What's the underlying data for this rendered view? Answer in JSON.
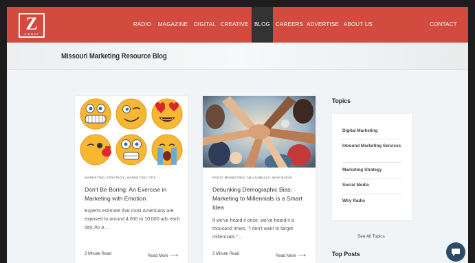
{
  "logo": {
    "letter": "Z",
    "subtitle": "ZIMMER"
  },
  "nav": {
    "items": [
      "RADIO",
      "MAGAZINE",
      "DIGITAL",
      "CREATIVE",
      "BLOG",
      "CAREERS",
      "ADVERTISE",
      "ABOUT US"
    ],
    "active": "BLOG",
    "contact": "CONTACT"
  },
  "page": {
    "title": "Missouri Marketing Resource Blog"
  },
  "posts": [
    {
      "categories": "MARKETING STRATEGY, MARKETING TIPS",
      "title": "Don't Be Boring: An Exercise in Marketing with Emotion",
      "excerpt": "Experts estimate that most Americans are exposed to around 4,000 to 10,000 ads each day. As a…",
      "read_time": "3 Minute Read",
      "read_more": "Read More"
    },
    {
      "categories": "RADIO MARKETING, MILLENNIALS, WHY RADIO",
      "title": "Debunking Demographic Bias: Marketing to Millennials is a Smart Idea",
      "excerpt": "If we've heard it once, we've heard it a thousand times, \"I don't want to target millennials.\"…",
      "read_time": "3 Minute Read",
      "read_more": "Read More"
    }
  ],
  "sidebar": {
    "topics_heading": "Topics",
    "topics": [
      "Digital Marketing",
      "Inbound Marketing Services",
      "Marketing Strategy",
      "Social Media",
      "Why Radio"
    ],
    "see_all": "See All Topics",
    "top_posts_heading": "Top Posts"
  },
  "colors": {
    "header": "#d24b3e",
    "nav_active": "#333333",
    "chat": "#2d4a66"
  },
  "icons": [
    "logo-z",
    "arrow-right-icon",
    "chat-icon"
  ]
}
